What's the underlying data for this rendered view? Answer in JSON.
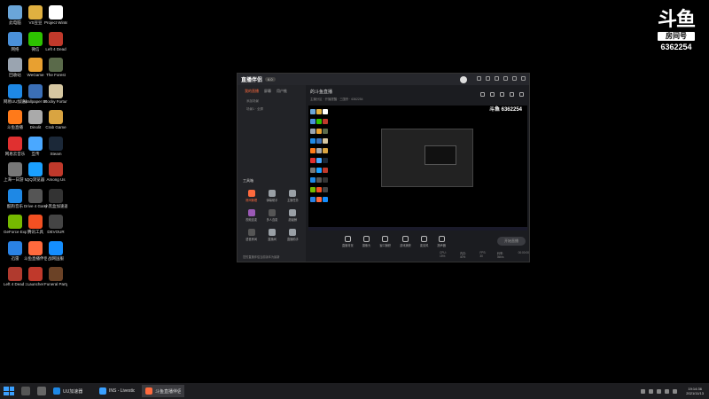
{
  "desktop": {
    "icons": [
      {
        "label": "此电脑",
        "color": "#6aa5d8"
      },
      {
        "label": "VS豆豆",
        "color": "#e0b040"
      },
      {
        "label": "Project Winter",
        "color": "#ffffff"
      },
      {
        "label": "网络",
        "color": "#4a90d9"
      },
      {
        "label": "微信",
        "color": "#2dc100"
      },
      {
        "label": "Left 4 Dead",
        "color": "#c0392b"
      },
      {
        "label": "回收站",
        "color": "#9aa4b0"
      },
      {
        "label": "WeGame",
        "color": "#e8a030"
      },
      {
        "label": "The Forest",
        "color": "#5a6a4a"
      },
      {
        "label": "网易UU加速器",
        "color": "#1e88e5"
      },
      {
        "label": "Wallpaper Engine",
        "color": "#3b6fb6"
      },
      {
        "label": "Rocky Fortune",
        "color": "#d6c7a1"
      },
      {
        "label": "斗鱼直播",
        "color": "#ff7a1a"
      },
      {
        "label": "Dinolit",
        "color": "#aaaaaa"
      },
      {
        "label": "Crab Game",
        "color": "#d9a441"
      },
      {
        "label": "网易云音乐",
        "color": "#e03030"
      },
      {
        "label": "互传",
        "color": "#4aa8ff"
      },
      {
        "label": "Steam",
        "color": "#1b2838"
      },
      {
        "label": "上海一日游 Mo..",
        "color": "#777777"
      },
      {
        "label": "QQ浏览器",
        "color": "#1aa0ff"
      },
      {
        "label": "Among Us",
        "color": "#c0392b"
      },
      {
        "label": "酷狗音乐",
        "color": "#1e88e5"
      },
      {
        "label": "Drive 4 Game",
        "color": "#555555"
      },
      {
        "label": "小黑盒加速器",
        "color": "#333333"
      },
      {
        "label": "GeForce Experience",
        "color": "#76b900"
      },
      {
        "label": "腾讯工具",
        "color": "#f25022"
      },
      {
        "label": "DEVOUR",
        "color": "#444444"
      },
      {
        "label": "迅雷",
        "color": "#2a82e4"
      },
      {
        "label": "斗鱼直播伴侣",
        "color": "#ff6a3d"
      },
      {
        "label": "战网国服",
        "color": "#148eff"
      },
      {
        "label": "Left 4 Dead 2",
        "color": "#b03a2e"
      },
      {
        "label": "Launcher",
        "color": "#c0392b"
      },
      {
        "label": "Funeral Party",
        "color": "#6b4226"
      }
    ]
  },
  "watermark": {
    "logo": "斗鱼",
    "room_label": "房间号",
    "room_id": "6362254"
  },
  "app": {
    "title": "直播伴侣",
    "badge": "6.0",
    "tabs": [
      "我的直播",
      "屏幕",
      "用户推"
    ],
    "side_rows": [
      "添加场景",
      "场景1 · 全屏"
    ],
    "tools_title": "工具箱",
    "tools": [
      {
        "label": "房间管理",
        "hot": true,
        "color": "#ff6a3d"
      },
      {
        "label": "弹幕助手",
        "hot": false,
        "color": "#9aa0a6"
      },
      {
        "label": "主播任务",
        "hot": false,
        "color": "#9aa0a6"
      },
      {
        "label": "视频连麦",
        "hot": false,
        "color": "#9b59b6"
      },
      {
        "label": "多人连麦",
        "hot": false,
        "color": "#555555"
      },
      {
        "label": "超级鲸",
        "hot": false,
        "color": "#9aa0a6"
      },
      {
        "label": "语音房间",
        "hot": false,
        "color": "#555555"
      },
      {
        "label": "直播间",
        "hot": false,
        "color": "#9aa0a6"
      },
      {
        "label": "直播助手",
        "hot": false,
        "color": "#9aa0a6"
      }
    ],
    "footer": "您的直播伴侣当前版本为最新",
    "room_title": "的斗鱼直播",
    "room_meta": "主播分区 · 开播提醒 · 三国杀 · 6362254",
    "controls": [
      "直播背景",
      "摄像头",
      "窗口捕获",
      "游戏捕获",
      "麦克风",
      "扬声器"
    ],
    "start_label": "开始直播",
    "status": [
      "CPU: 15%",
      "内存: 40%",
      "FPS: 30",
      "码率: 0kb/s",
      "00:00:00"
    ],
    "preview_watermark": "斗鱼 6362254"
  },
  "taskbar": {
    "tasks": [
      {
        "label": "UU加速器",
        "color": "#1e88e5",
        "active": false
      },
      {
        "label": "INS - Livestick Gi...",
        "color": "#3aa0ff",
        "active": false
      },
      {
        "label": "斗鱼直播伴侣",
        "color": "#ff6a3d",
        "active": true
      }
    ],
    "time": "19:14:36",
    "date": "2021/11/13"
  }
}
